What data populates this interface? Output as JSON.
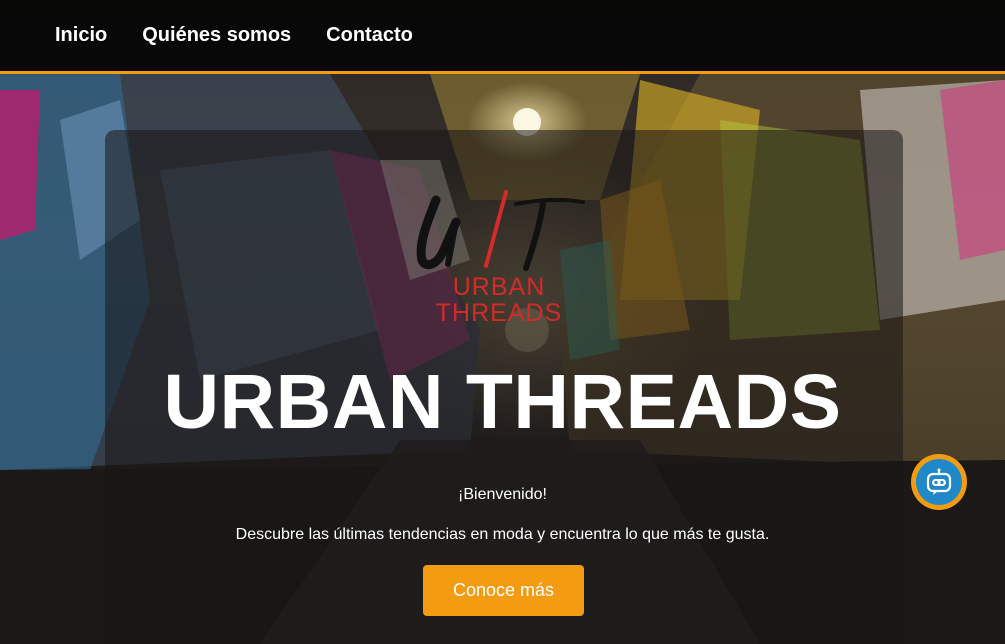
{
  "nav": {
    "items": [
      {
        "label": "Inicio"
      },
      {
        "label": "Quiénes somos"
      },
      {
        "label": "Contacto"
      }
    ]
  },
  "hero": {
    "logo_line1": "URBAN",
    "logo_line2": "THREADS",
    "title": "URBAN THREADS",
    "welcome": "¡Bienvenido!",
    "description": "Descubre las últimas tendencias en moda y encuentra lo que más te gusta.",
    "cta_label": "Conoce más"
  },
  "colors": {
    "accent": "#f39c12",
    "logo_red": "#d42a2a",
    "chatbot_blue": "#1e88c8"
  },
  "icons": {
    "chatbot": "robot-chat-icon",
    "logo_mark": "ut-logo-icon"
  }
}
